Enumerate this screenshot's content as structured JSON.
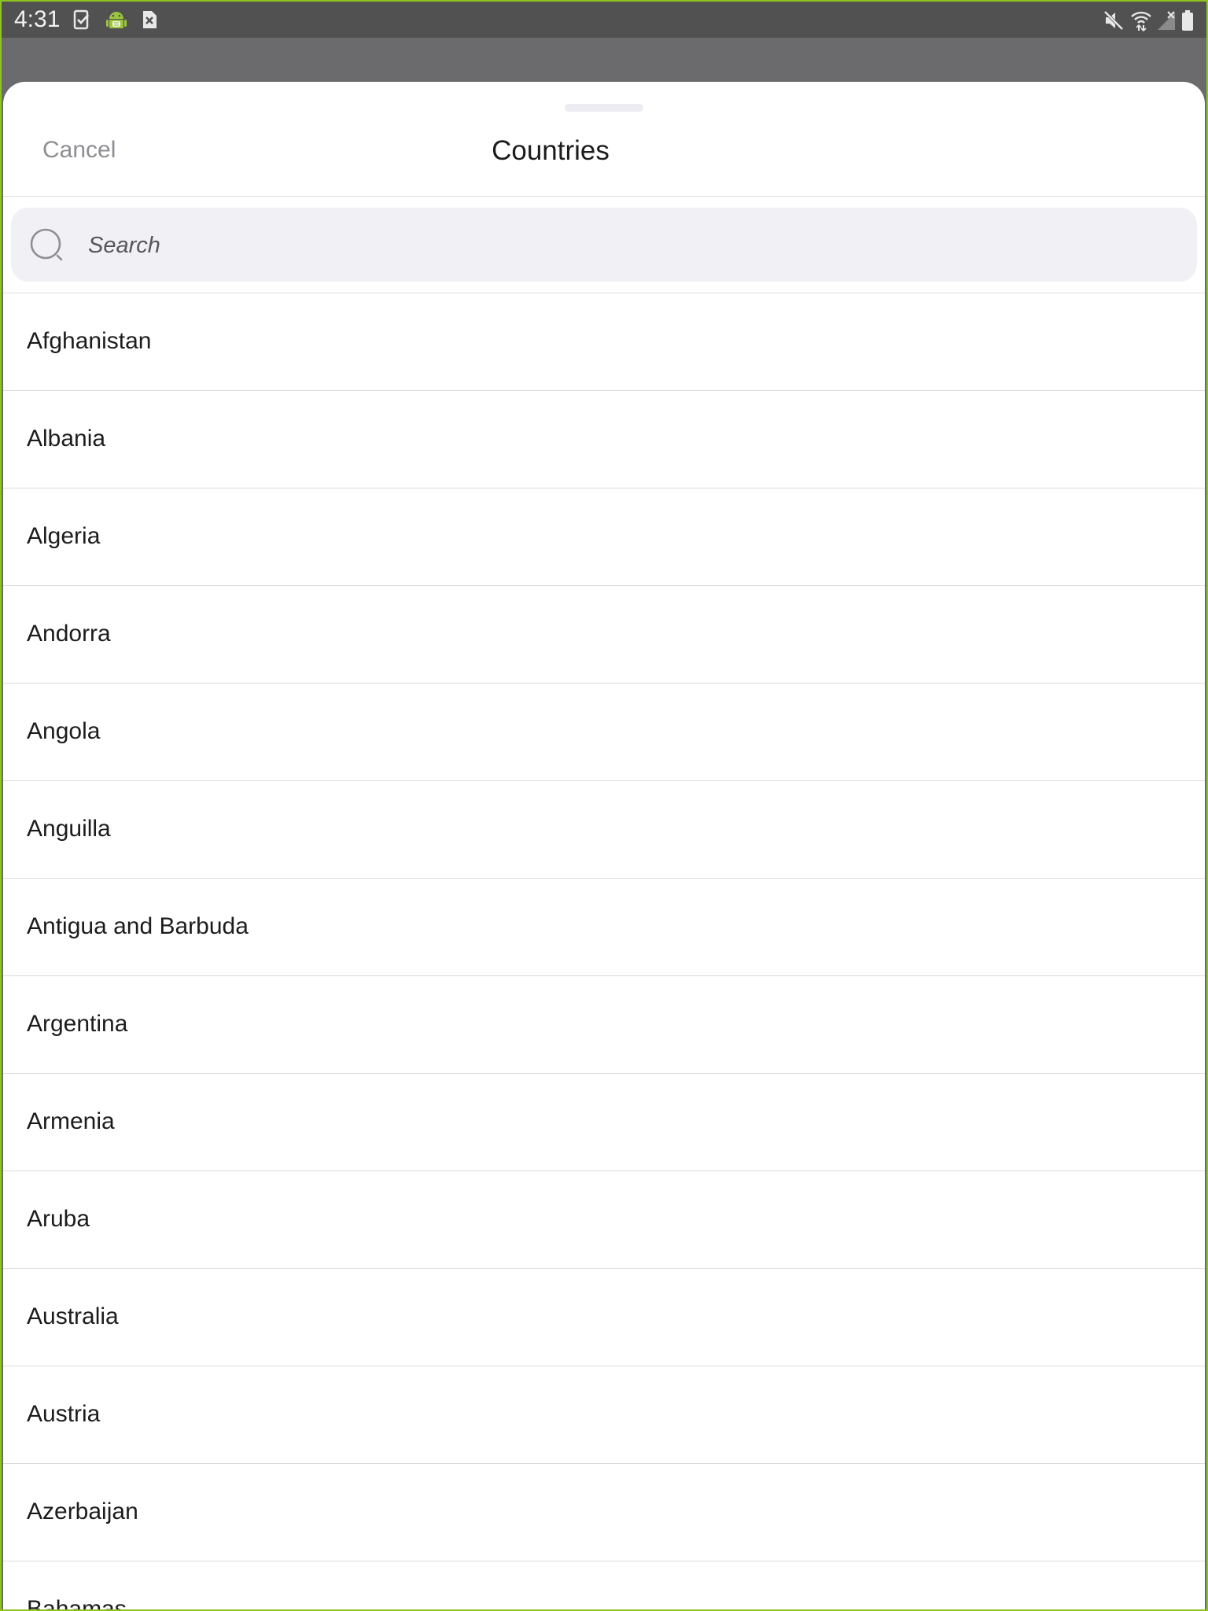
{
  "status_bar": {
    "time": "4:31",
    "left_icons": [
      "task-check-icon",
      "android-icon",
      "sim-error-icon"
    ],
    "right_icons": [
      "mute-icon",
      "wifi-icon",
      "no-signal-icon",
      "battery-icon"
    ]
  },
  "sheet": {
    "cancel_label": "Cancel",
    "title": "Countries"
  },
  "search": {
    "placeholder": "Search",
    "value": ""
  },
  "countries": [
    "Afghanistan",
    "Albania",
    "Algeria",
    "Andorra",
    "Angola",
    "Anguilla",
    "Antigua and Barbuda",
    "Argentina",
    "Armenia",
    "Aruba",
    "Australia",
    "Austria",
    "Azerbaijan",
    "Bahamas"
  ],
  "colors": {
    "status_bar_bg": "#515151",
    "scrim": "#6b6b6d",
    "frame": "#8fc31f",
    "search_bg": "#f1f1f5",
    "divider": "#dcdce0",
    "text_primary": "#1c1c1e",
    "text_secondary": "#8e8e93"
  }
}
